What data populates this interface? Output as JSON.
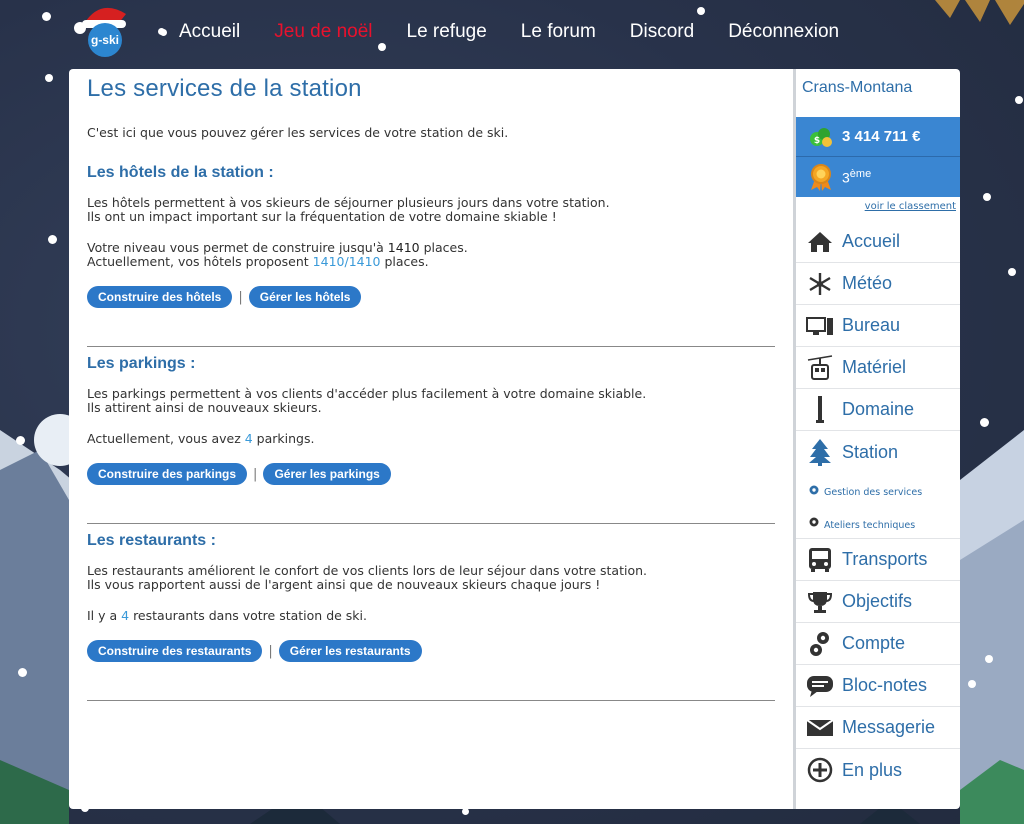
{
  "nav": {
    "items": [
      {
        "label": "Accueil",
        "active": false
      },
      {
        "label": "Jeu de noël",
        "active": true
      },
      {
        "label": "Le refuge",
        "active": false
      },
      {
        "label": "Le forum",
        "active": false
      },
      {
        "label": "Discord",
        "active": false
      },
      {
        "label": "Déconnexion",
        "active": false
      }
    ],
    "logo_text": "g-ski"
  },
  "main": {
    "title": "Les services de la station",
    "intro": "C'est ici que vous pouvez gérer les services de votre station de ski.",
    "hotels": {
      "title": "Les hôtels de la station :",
      "desc_line1": "Les hôtels permettent à vos skieurs de séjourner plusieurs jours dans votre station.",
      "desc_line2": "Ils ont un impact important sur la fréquentation de votre domaine skiable !",
      "level_prefix": "Votre niveau vous permet de construire jusqu'à ",
      "level_value": "1410",
      "level_suffix": " places.",
      "current_prefix": "Actuellement, vos hôtels proposent ",
      "current_value": "1410/1410",
      "current_suffix": " places.",
      "build_label": "Construire des hôtels",
      "manage_label": "Gérer les hôtels"
    },
    "parkings": {
      "title": "Les parkings :",
      "desc_line1": "Les parkings permettent à vos clients d'accéder plus facilement à votre domaine skiable.",
      "desc_line2": "Ils attirent ainsi de nouveaux skieurs.",
      "count_prefix": "Actuellement, vous avez ",
      "count_value": "4",
      "count_suffix": " parkings.",
      "build_label": "Construire des parkings",
      "manage_label": "Gérer les parkings"
    },
    "restaurants": {
      "title": "Les restaurants :",
      "desc_line1": "Les restaurants améliorent le confort de vos clients lors de leur séjour dans votre station.",
      "desc_line2": "Ils vous rapportent aussi de l'argent ainsi que de nouveaux skieurs chaque jours !",
      "count_prefix": "Il y a ",
      "count_value": "4",
      "count_suffix": " restaurants dans votre station de ski.",
      "build_label": "Construire des restaurants",
      "manage_label": "Gérer les restaurants"
    },
    "separator": "|"
  },
  "sidebar": {
    "station_name": "Crans-Montana",
    "money": "3 414 711 €",
    "rank_number": "3",
    "rank_suffix": "ème",
    "rank_link": "voir le classement",
    "menu": [
      {
        "label": "Accueil",
        "icon": "home-icon"
      },
      {
        "label": "Météo",
        "icon": "snowflake-icon"
      },
      {
        "label": "Bureau",
        "icon": "computer-icon"
      },
      {
        "label": "Matériel",
        "icon": "gondola-icon"
      },
      {
        "label": "Domaine",
        "icon": "ski-pole-icon"
      },
      {
        "label": "Station",
        "icon": "tree-icon"
      },
      {
        "label": "Transports",
        "icon": "bus-icon"
      },
      {
        "label": "Objectifs",
        "icon": "trophy-icon"
      },
      {
        "label": "Compte",
        "icon": "gears-icon"
      },
      {
        "label": "Bloc-notes",
        "icon": "chat-icon"
      },
      {
        "label": "Messagerie",
        "icon": "envelope-icon"
      },
      {
        "label": "En plus",
        "icon": "plus-circle-icon"
      }
    ],
    "submenu": [
      {
        "label": "Gestion des services",
        "icon": "gear-icon"
      },
      {
        "label": "Ateliers techniques",
        "icon": "gear-icon"
      }
    ]
  },
  "colors": {
    "accent": "#2e6ea8",
    "button": "#2c78c8",
    "active_nav": "#e8112d",
    "highlight": "#3a9ad9"
  }
}
